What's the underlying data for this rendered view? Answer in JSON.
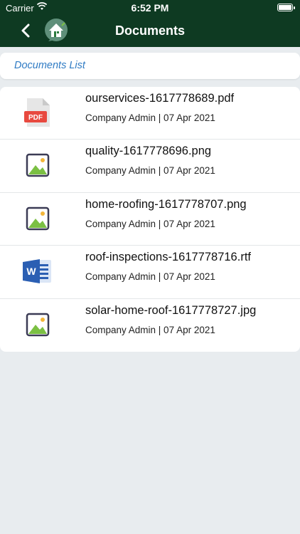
{
  "status_bar": {
    "carrier": "Carrier",
    "time": "6:52 PM"
  },
  "nav": {
    "title": "Documents",
    "back_icon": "chevron-left-icon",
    "logo_icon": "home-logo-icon"
  },
  "section": {
    "label": "Documents List"
  },
  "colors": {
    "header_bg": "#0e3a22",
    "section_label": "#2f7bc4",
    "pdf_red": "#e8493f",
    "word_blue": "#2b5fb3",
    "image_green": "#7bc043"
  },
  "documents": [
    {
      "name": "ourservices-1617778689.pdf",
      "meta": "Company Admin | 07 Apr 2021",
      "icon": "pdf-file-icon"
    },
    {
      "name": "quality-1617778696.png",
      "meta": "Company Admin | 07 Apr 2021",
      "icon": "image-file-icon"
    },
    {
      "name": "home-roofing-1617778707.png",
      "meta": "Company Admin | 07 Apr 2021",
      "icon": "image-file-icon"
    },
    {
      "name": "roof-inspections-1617778716.rtf",
      "meta": "Company Admin | 07 Apr 2021",
      "icon": "word-file-icon"
    },
    {
      "name": "solar-home-roof-1617778727.jpg",
      "meta": "Company Admin | 07 Apr 2021",
      "icon": "image-file-icon"
    }
  ]
}
